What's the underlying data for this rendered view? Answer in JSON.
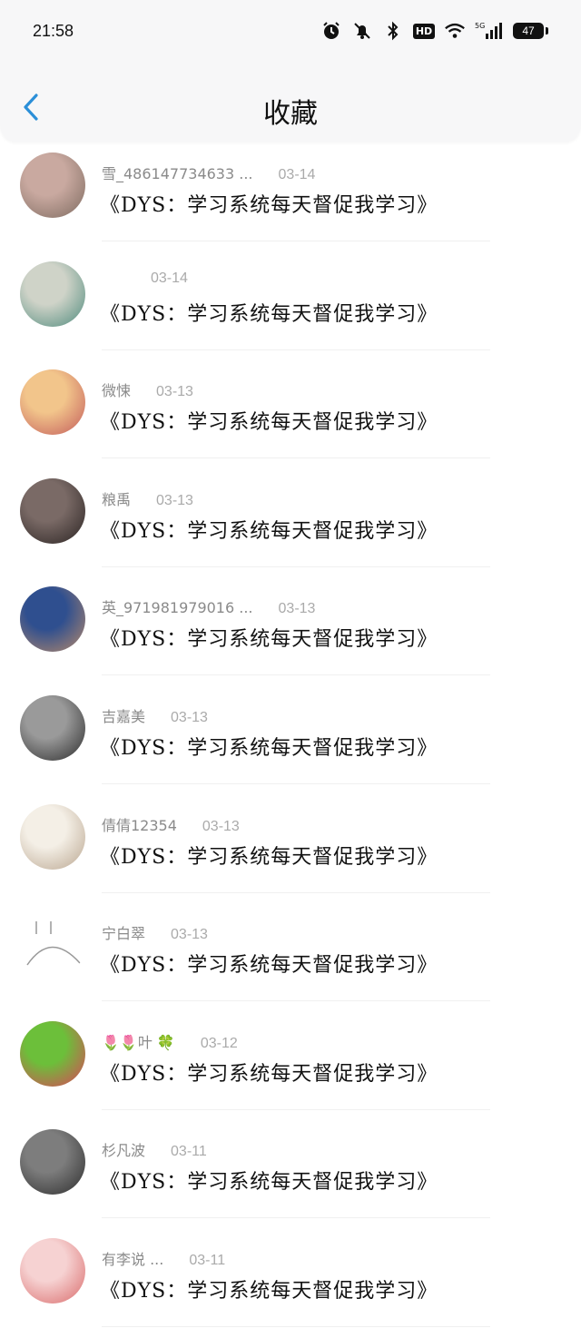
{
  "status_bar": {
    "time": "21:58",
    "battery": "47",
    "network": "5G",
    "hd": "HD"
  },
  "header": {
    "title": "收藏",
    "back_icon": "chevron-left-icon"
  },
  "items": [
    {
      "user": "雪_486147734633 ...",
      "date": "03-14",
      "content": "《DYS：学习系统每天督促我学习》",
      "avatar_colors": [
        "#c9a9a0",
        "#7d6a5f"
      ]
    },
    {
      "user": "",
      "date": "03-14",
      "content": "《DYS：学习系统每天督促我学习》",
      "avatar_colors": [
        "#cfd3c8",
        "#4e8a7c"
      ]
    },
    {
      "user": "微悚",
      "date": "03-13",
      "content": "《DYS：学习系统每天督促我学习》",
      "avatar_colors": [
        "#f2c58b",
        "#c25a5a"
      ]
    },
    {
      "user": "粮禹",
      "date": "03-13",
      "content": "《DYS：学习系统每天督促我学习》",
      "avatar_colors": [
        "#7a6a66",
        "#2a2322"
      ]
    },
    {
      "user": "英_971981979016 ...",
      "date": "03-13",
      "content": "《DYS：学习系统每天督促我学习》",
      "avatar_colors": [
        "#2f4f8f",
        "#b88a6a"
      ]
    },
    {
      "user": "吉嘉美",
      "date": "03-13",
      "content": "《DYS：学习系统每天督促我学习》",
      "avatar_colors": [
        "#9a9a9a",
        "#2b2b2b"
      ]
    },
    {
      "user": "倩倩12354",
      "date": "03-13",
      "content": "《DYS：学习系统每天督促我学习》",
      "avatar_colors": [
        "#f4efe6",
        "#b9a58f"
      ]
    },
    {
      "user": "宁白翠",
      "date": "03-13",
      "content": "《DYS：学习系统每天督促我学习》",
      "avatar_colors": [
        "#ffffff",
        "#bbbbbb"
      ]
    },
    {
      "user": "🌷🌷叶 🍀",
      "date": "03-12",
      "content": "《DYS：学习系统每天督促我学习》",
      "avatar_colors": [
        "#6cbf3a",
        "#e0405a"
      ]
    },
    {
      "user": "杉凡波",
      "date": "03-11",
      "content": "《DYS：学习系统每天督促我学习》",
      "avatar_colors": [
        "#7d7d7d",
        "#2d2d2d"
      ]
    },
    {
      "user": "有李说 ...",
      "date": "03-11",
      "content": "《DYS：学习系统每天督促我学习》",
      "avatar_colors": [
        "#f6d2d2",
        "#d96a6a"
      ]
    }
  ]
}
